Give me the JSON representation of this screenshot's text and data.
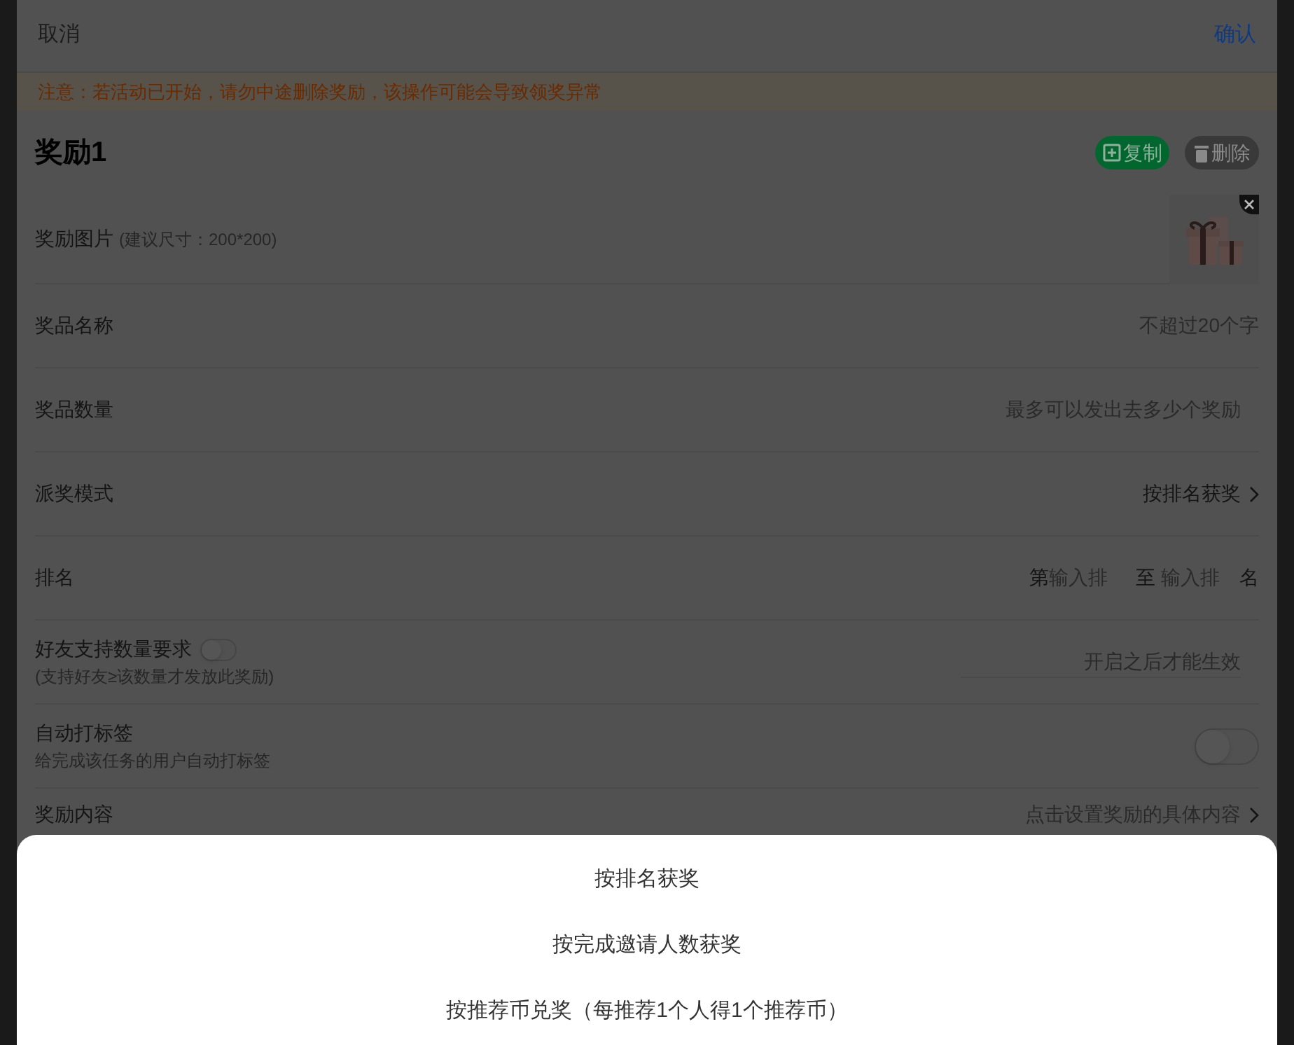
{
  "header": {
    "cancel": "取消",
    "confirm": "确认"
  },
  "notice": "注意：若活动已开始，请勿中途删除奖励，该操作可能会导致领奖异常",
  "reward": {
    "title": "奖励1",
    "copy_button": "复制",
    "delete_button": "删除"
  },
  "image_row": {
    "label": "奖励图片",
    "hint": "(建议尺寸：200*200)"
  },
  "fields": [
    {
      "kind": "input",
      "label": "奖品名称",
      "placeholder": "不超过20个字"
    },
    {
      "kind": "input",
      "label": "奖品数量",
      "placeholder": "最多可以发出去多少个奖励"
    },
    {
      "kind": "select",
      "label": "派奖模式",
      "value": "按排名获奖"
    },
    {
      "kind": "range",
      "label": "排名",
      "prefix": "第",
      "from_placeholder": "输入排",
      "middle": "至",
      "to_placeholder": "输入排",
      "suffix": "名"
    },
    {
      "kind": "toggle_input",
      "label": "好友支持数量要求",
      "sublabel": "(支持好友≥该数量才发放此奖励)",
      "on": false,
      "placeholder": "开启之后才能生效"
    },
    {
      "kind": "toggle",
      "label": "自动打标签",
      "sublabel": "给完成该任务的用户自动打标签",
      "on": false
    },
    {
      "kind": "link",
      "label": "奖励内容",
      "placeholder": "点击设置奖励的具体内容"
    }
  ],
  "sheet_options": [
    "按排名获奖",
    "按完成邀请人数获奖",
    "按推荐币兑奖（每推荐1个人得1个推荐币）"
  ]
}
